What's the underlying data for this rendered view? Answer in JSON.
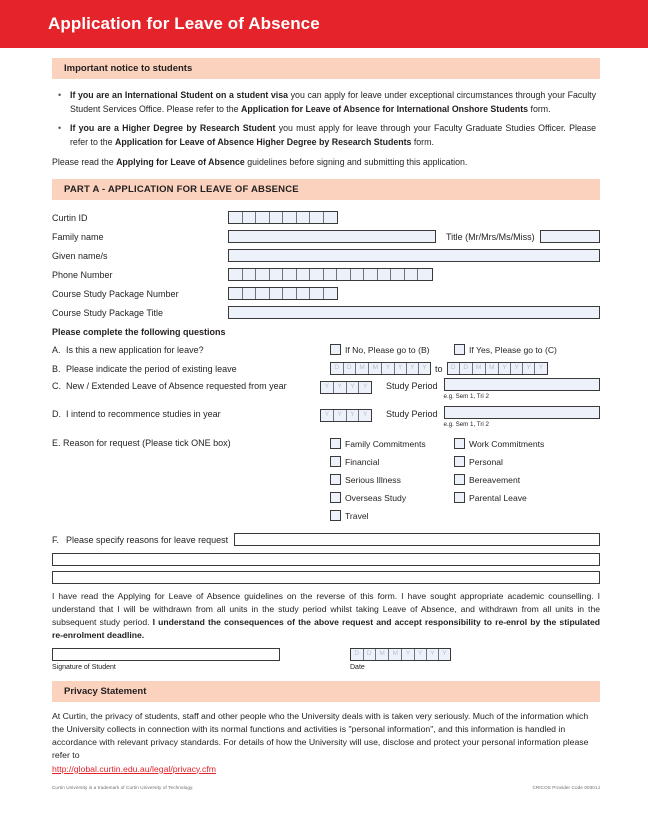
{
  "header": {
    "title": "Application for Leave of Absence",
    "bar_color": "#E5232B"
  },
  "notice": {
    "banner": "Important notice to students",
    "bullets": [
      {
        "bold_lead": "If you are an International Student on a student visa",
        "text_1": " you can apply for leave under exceptional circumstances through your Faculty Student Services Office. Please refer to the ",
        "bold_mid": "Application for Leave of Absence for International Onshore Students",
        "text_2": " form."
      },
      {
        "bold_lead": "If you are a Higher Degree by Research Student",
        "text_1": " you must apply for leave through your Faculty Graduate Studies Officer. Please refer to the ",
        "bold_mid": "Application for Leave of Absence Higher Degree by Research Students",
        "text_2": " form."
      }
    ],
    "closing_pre": "Please read the ",
    "closing_bold": "Applying for Leave of Absence",
    "closing_post": " guidelines before signing and submitting this application."
  },
  "part_a": {
    "banner": "PART A - APPLICATION FOR LEAVE OF ABSENCE",
    "fields": {
      "curtin_id": {
        "label": "Curtin ID",
        "cells": 8
      },
      "family_name": {
        "label": "Family name"
      },
      "title": {
        "label": "Title (Mr/Mrs/Ms/Miss)"
      },
      "given_names": {
        "label": "Given name/s"
      },
      "phone_number": {
        "label": "Phone Number",
        "cells": 15
      },
      "course_package_number": {
        "label": "Course Study Package Number",
        "cells": 8
      },
      "course_package_title": {
        "label": "Course Study Package Title"
      }
    },
    "questions_heading": "Please complete the following questions",
    "question_a": {
      "marker": "A.",
      "label": "Is this a new application for leave?",
      "option_no": "If No, Please go to (B)",
      "option_yes": "If Yes, Please go to (C)"
    },
    "question_b": {
      "marker": "B.",
      "label": "Please indicate the period of existing leave",
      "date_mask": [
        "D",
        "D",
        "M",
        "M",
        "Y",
        "Y",
        "Y",
        "Y"
      ],
      "to": "to"
    },
    "question_c": {
      "marker": "C.",
      "label": "New / Extended Leave of Absence requested from year",
      "year_mask": [
        "Y",
        "Y",
        "Y",
        "Y"
      ],
      "study_period_label": "Study Period",
      "hint": "e.g. Sem 1, Tri 2"
    },
    "question_d": {
      "marker": "D.",
      "label": "I intend to recommence studies in year",
      "year_mask": [
        "Y",
        "Y",
        "Y",
        "Y"
      ],
      "study_period_label": "Study Period",
      "hint": "e.g. Sem 1, Tri 2"
    },
    "question_e": {
      "marker": "E.",
      "label": "Reason for request (Please tick ONE box)",
      "reasons_left": [
        "Family Commitments",
        "Financial",
        "Serious Illness",
        "Overseas Study",
        "Travel"
      ],
      "reasons_right": [
        "Work Commitments",
        "Personal",
        "Bereavement",
        "Parental Leave"
      ]
    },
    "question_f": {
      "marker": "F.",
      "label": "Please specify reasons for leave request"
    }
  },
  "declaration": {
    "text_1": "I have read the Applying for Leave of Absence guidelines on the reverse of this form. I have sought appropriate academic counselling. I understand that I will be withdrawn from all units in the study period whilst taking Leave of Absence, and withdrawn from all units in the subsequent study period. ",
    "text_bold": "I understand the consequences of the above request and accept responsibility to re-enrol by the stipulated re-enrolment deadline.",
    "signature_label": "Signature of Student",
    "date_label": "Date",
    "date_mask": [
      "D",
      "D",
      "M",
      "M",
      "Y",
      "Y",
      "Y",
      "Y"
    ]
  },
  "privacy": {
    "banner": "Privacy Statement",
    "body": "At Curtin, the privacy of students, staff and other people who the University deals with is taken very seriously. Much of the information which the University collects in connection with its normal functions and activities is \"personal information\", and this information is handled in accordance with relevant privacy standards. For details of how the University will use, disclose and protect your personal information please refer to",
    "link": "http://global.curtin.edu.au/legal/privacy.cfm"
  },
  "footer": {
    "left": "Curtin University is a trademark of Curtin University of Technology.",
    "right": "CRICOS Provider Code 00301J"
  }
}
